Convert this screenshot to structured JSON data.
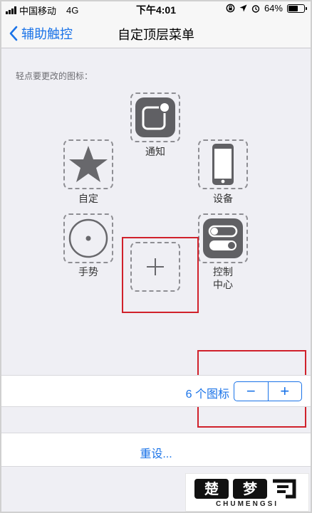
{
  "status_bar": {
    "carrier": "中国移动",
    "network": "4G",
    "time": "下午4:01",
    "battery": "64%",
    "battery_level": 0.64
  },
  "nav": {
    "back_label": "辅助触控",
    "title": "自定顶层菜单"
  },
  "hint": "轻点要更改的图标：",
  "icons": [
    {
      "label": "通知",
      "icon": "notification-icon"
    },
    {
      "label": "自定",
      "icon": "star-icon"
    },
    {
      "label": "设备",
      "icon": "device-icon"
    },
    {
      "label": "手势",
      "icon": "gesture-icon"
    },
    {
      "label": "",
      "icon": "plus-icon"
    },
    {
      "label": "控制\n中心",
      "icon": "control-center-icon"
    }
  ],
  "count": {
    "label": "6 个图标",
    "minus": "−",
    "plus": "+"
  },
  "reset": {
    "label": "重设..."
  },
  "watermark": {
    "brand": "楚梦",
    "site": "CHUMENGSI"
  }
}
